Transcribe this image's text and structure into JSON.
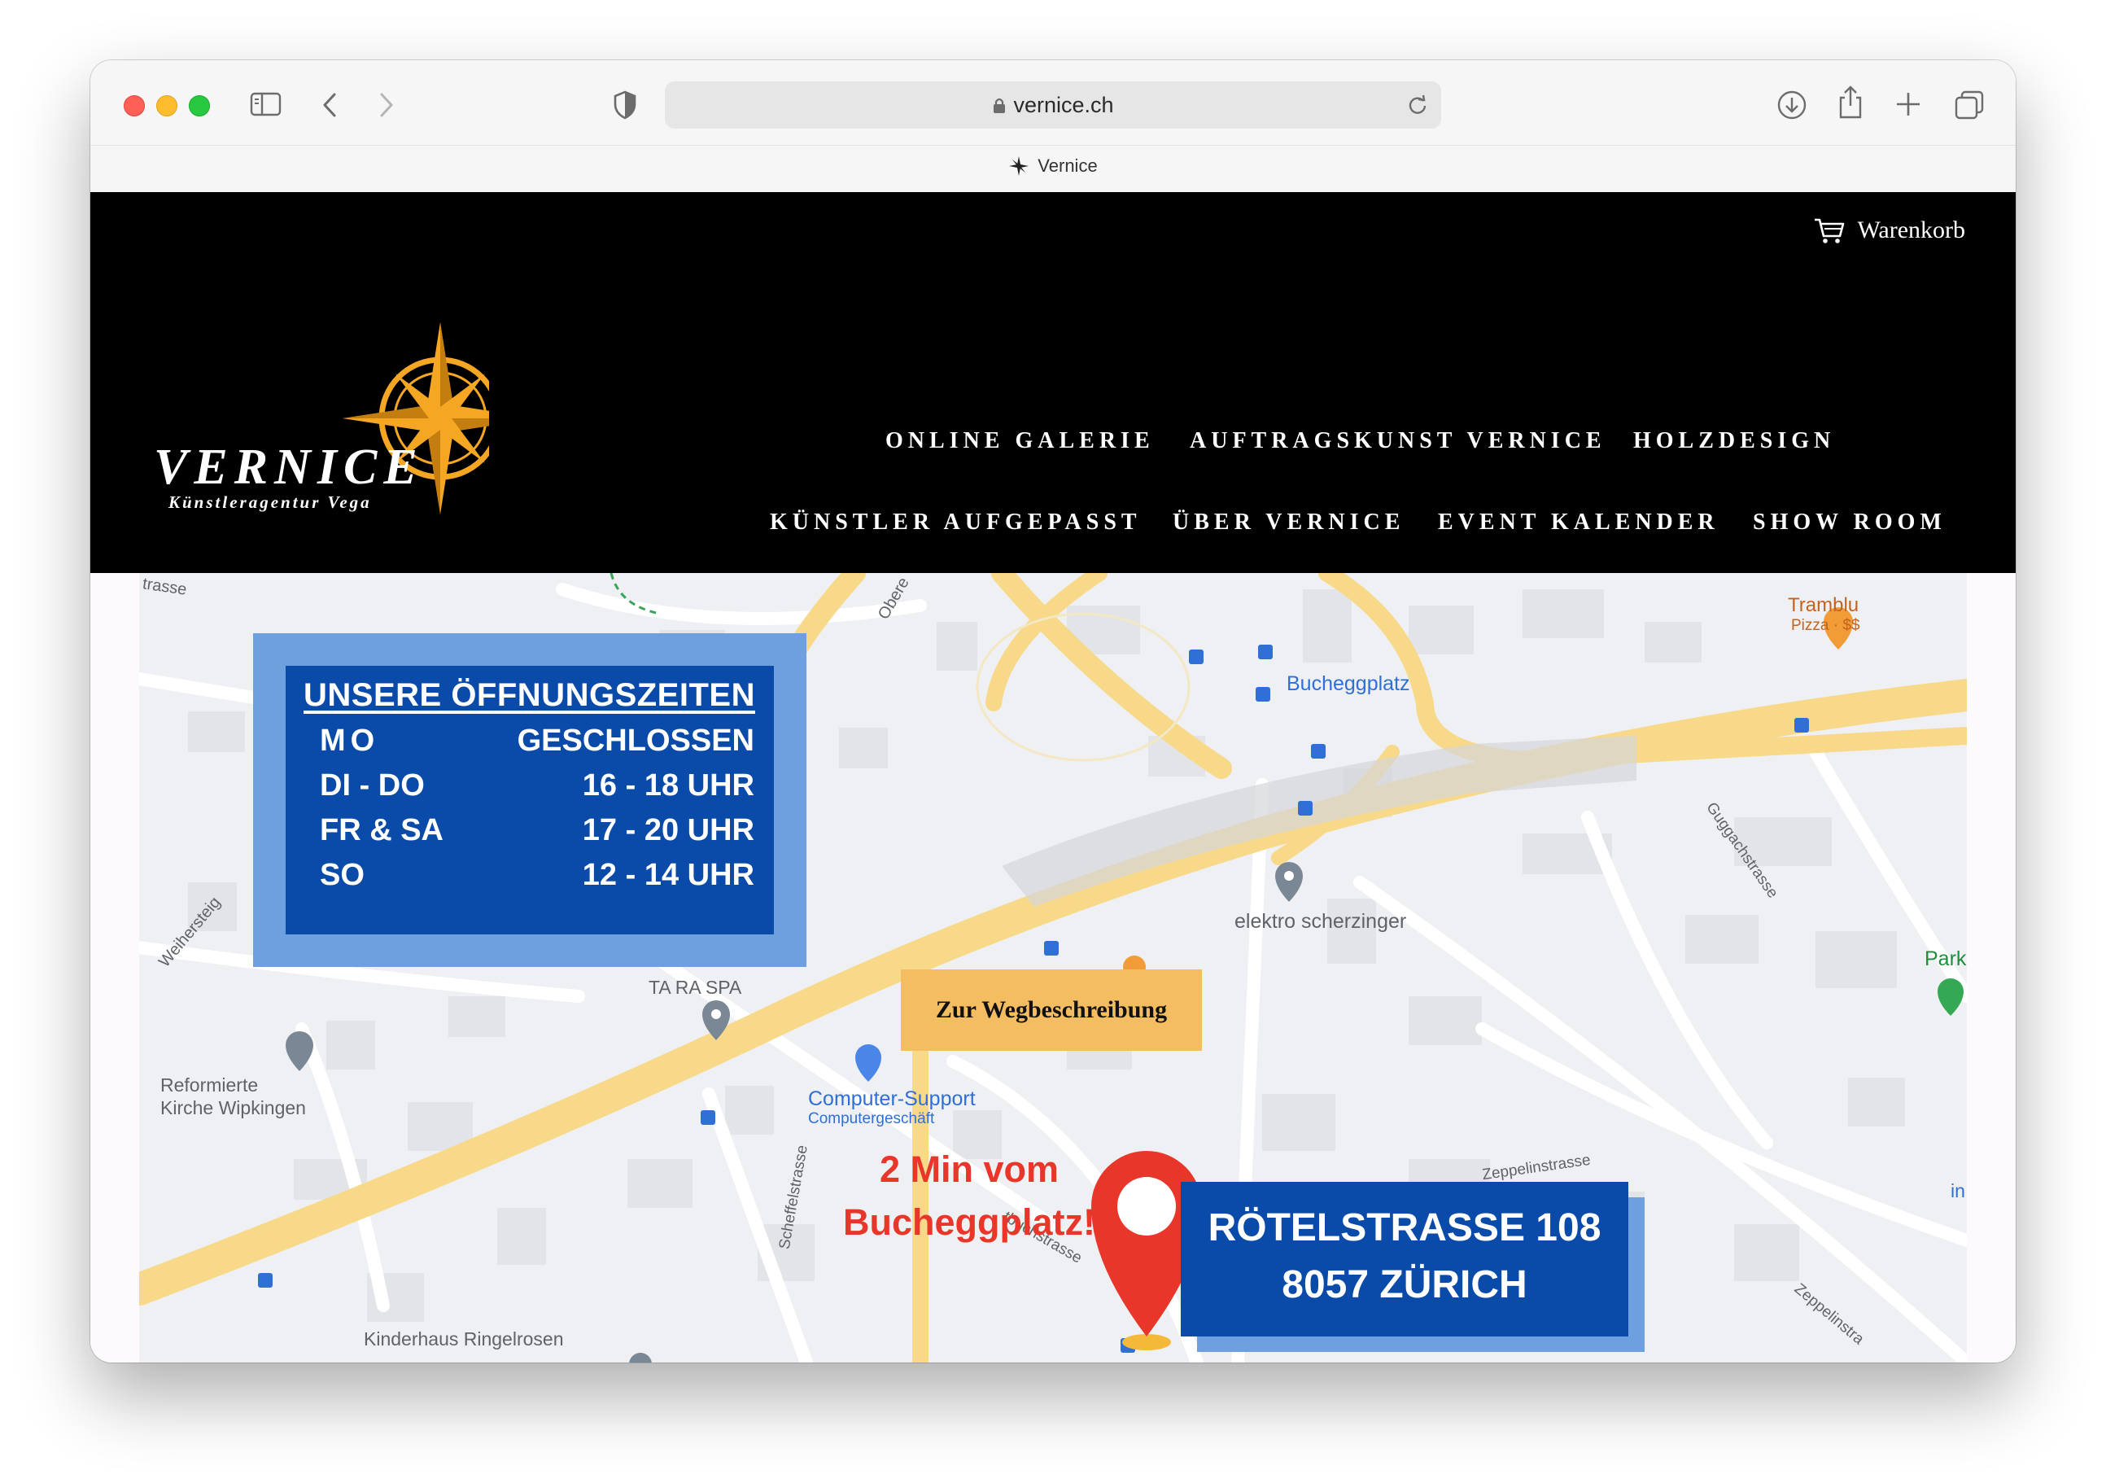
{
  "browser": {
    "url": "vernice.ch",
    "tab_title": "Vernice"
  },
  "header": {
    "cart_label": "Warenkorb",
    "logo_text": "VERNICE",
    "logo_subtitle": "Künstleragentur Vega",
    "nav_row1": [
      "ONLINE GALERIE",
      "AUFTRAGSKUNST VERNICE",
      "HOLZDESIGN"
    ],
    "nav_row2": [
      "KÜNSTLER AUFGEPASST",
      "ÜBER VERNICE",
      "EVENT KALENDER",
      "SHOW ROOM"
    ]
  },
  "hours": {
    "title": "UNSERE ÖFFNUNGSZEITEN",
    "rows": [
      {
        "day": "MO",
        "time": "GESCHLOSSEN"
      },
      {
        "day": "DI - DO",
        "time": "16 - 18 UHR"
      },
      {
        "day": "FR & SA",
        "time": "17 - 20 UHR"
      },
      {
        "day": "SO",
        "time": "12 - 14 UHR"
      }
    ]
  },
  "map": {
    "route_button": "Zur Wegbeschreibung",
    "note_line1": "2 Min vom",
    "note_line2": "Bucheggplatz!",
    "address_line1": "RÖTELSTRASSE 108",
    "address_line2": "8057 ZÜRICH",
    "labels": {
      "strasse": "trasse",
      "obere": "Obere",
      "bucheggplatz": "Bucheggplatz",
      "tramblu": "Tramblu",
      "pizza": "Pizza · $$",
      "elektro": "elektro scherzinger",
      "ta_ra_spa": "TA RA SPA",
      "weihersteig": "Weihersteig",
      "kirche1": "Reformierte",
      "kirche2": "Kirche Wipkingen",
      "computer": "Computer-Support",
      "computer_sub": "Computergeschäft",
      "scheffelstrasse": "Scheffelstrasse",
      "rotbuchstrasse": "tbuchstrasse",
      "zeppelin1": "Zeppelinstrasse",
      "zeppelin2": "Zeppelinstra",
      "guggach": "Guggachstrasse",
      "park": "Park",
      "in": "in",
      "kinderhaus": "Kinderhaus Ringelrosen"
    }
  },
  "colors": {
    "header_bg": "#000000",
    "logo_gold": "#f5a623",
    "hours_blue": "#0a4aa8",
    "hours_light_blue": "#6ea0e0",
    "button_gold": "#f5bd62",
    "note_red": "#e8372a",
    "road_yellow": "#f8d98a"
  }
}
